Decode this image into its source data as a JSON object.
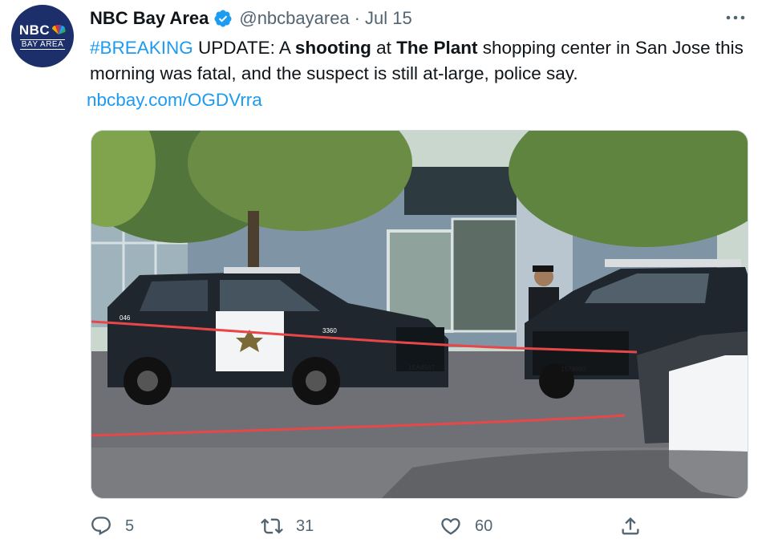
{
  "account": {
    "logo_text": "NBC",
    "logo_subtext": "BAY AREA",
    "display_name": "NBC Bay Area",
    "handle": "@nbcbayarea",
    "separator": "·",
    "date": "Jul 15"
  },
  "tweet": {
    "hashtag": "#BREAKING",
    "text_1": " UPDATE: A ",
    "bold_1": "shooting",
    "text_2": " at ",
    "bold_2": "The Plant",
    "text_3": " shopping center in San Jose this morning was fatal, and the suspect is still at-large, police say.",
    "url": "nbcbay.com/OGDVrra"
  },
  "media": {
    "vehicle_number": "3360",
    "plate_1": "1EA4567",
    "plate_2": "1579980",
    "unit_label": "046"
  },
  "actions": {
    "replies": "5",
    "retweets": "31",
    "likes": "60"
  },
  "icons": [
    "verified-icon",
    "more-icon",
    "reply-icon",
    "retweet-icon",
    "like-icon",
    "share-icon"
  ],
  "colors": {
    "link": "#1d9bf0",
    "muted": "#536471",
    "verified": "#1d9bf0",
    "avatar_bg": "#1d2f6b"
  }
}
